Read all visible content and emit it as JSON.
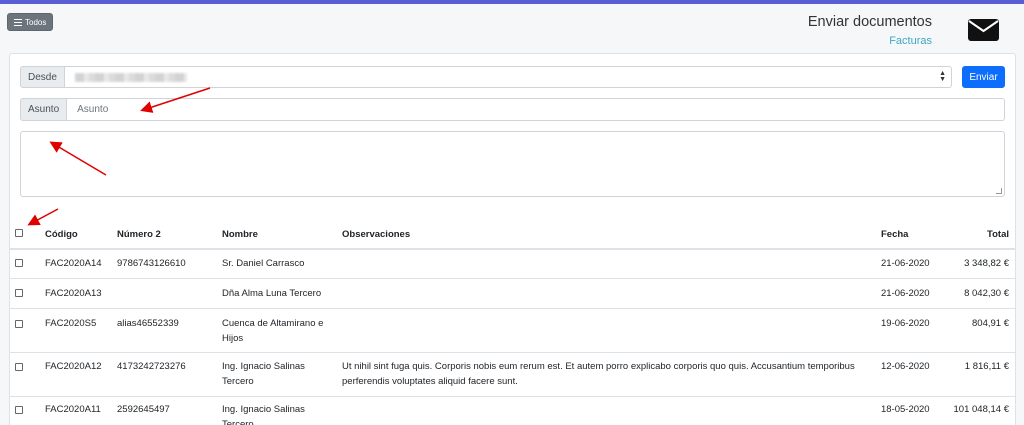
{
  "toolbar": {
    "todos_label": "Todos"
  },
  "header": {
    "title": "Enviar documentos",
    "subtitle": "Facturas"
  },
  "form": {
    "desde_label": "Desde",
    "enviar_label": "Enviar",
    "asunto_label": "Asunto",
    "asunto_placeholder": "Asunto"
  },
  "table": {
    "columns": [
      "Código",
      "Número 2",
      "Nombre",
      "Observaciones",
      "Fecha",
      "Total"
    ],
    "rows": [
      {
        "codigo": "FAC2020A14",
        "numero2": "9786743126610",
        "nombre": "Sr. Daniel Carrasco",
        "obs": "",
        "fecha": "21-06-2020",
        "total": "3 348,82 €"
      },
      {
        "codigo": "FAC2020A13",
        "numero2": "",
        "nombre": "Dña Alma Luna Tercero",
        "obs": "",
        "fecha": "21-06-2020",
        "total": "8 042,30 €"
      },
      {
        "codigo": "FAC2020S5",
        "numero2": "alias46552339",
        "nombre": "Cuenca de Altamirano e Hijos",
        "obs": "",
        "fecha": "19-06-2020",
        "total": "804,91 €"
      },
      {
        "codigo": "FAC2020A12",
        "numero2": "4173242723276",
        "nombre": "Ing. Ignacio Salinas Tercero",
        "obs": "Ut nihil sint fuga quis. Corporis nobis eum rerum est. Et autem porro explicabo corporis quo quis. Accusantium temporibus perferendis voluptates aliquid facere sunt.",
        "fecha": "12-06-2020",
        "total": "1 816,11 €"
      },
      {
        "codigo": "FAC2020A11",
        "numero2": "2592645497",
        "nombre": "Ing. Ignacio Salinas Tercero",
        "obs": "",
        "fecha": "18-05-2020",
        "total": "101 048,14 €"
      }
    ]
  },
  "colors": {
    "accent": "#0d6efd",
    "topbar": "#5b5fd6",
    "subtitle": "#3fa6c5",
    "annotation": "#e00000"
  }
}
